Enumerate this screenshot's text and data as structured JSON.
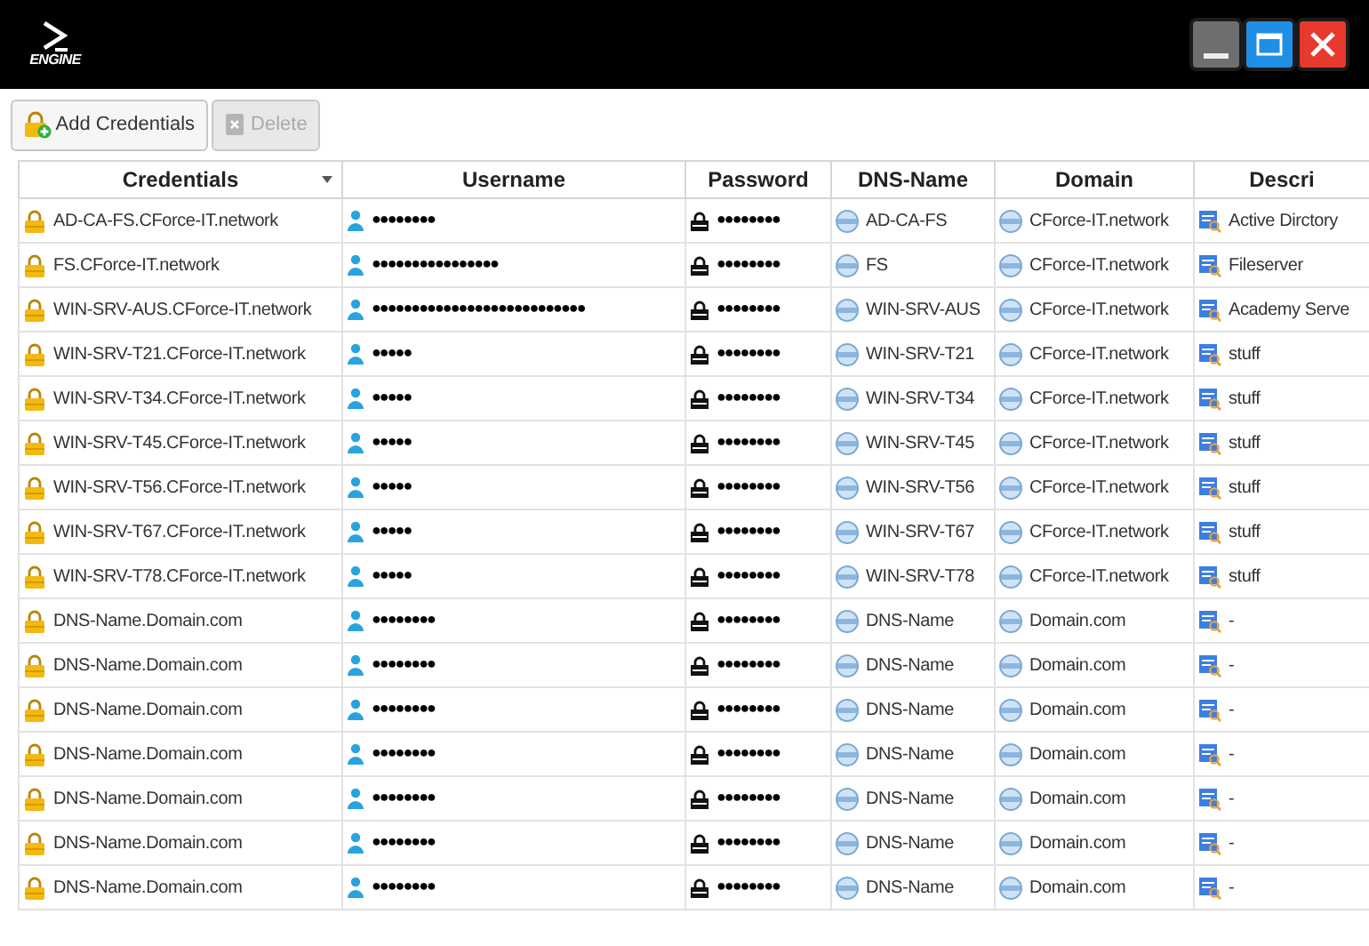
{
  "logo": {
    "text": "ENGINE"
  },
  "window_buttons": [
    {
      "kind": "minimize"
    },
    {
      "kind": "maximize"
    },
    {
      "kind": "close"
    }
  ],
  "toolbar": [
    {
      "label": "Add Credentials",
      "disabled": false,
      "kind": "add"
    },
    {
      "label": "Delete",
      "disabled": true,
      "kind": "delete"
    }
  ],
  "table": {
    "columns": [
      {
        "label": "Credentials",
        "sorted": true
      },
      {
        "label": "Username",
        "sorted": false
      },
      {
        "label": "Password",
        "sorted": false
      },
      {
        "label": "DNS-Name",
        "sorted": false
      },
      {
        "label": "Domain",
        "sorted": false
      },
      {
        "label": "Descri",
        "sorted": false
      }
    ],
    "rows": [
      {
        "credentials": "AD-CA-FS.CForce-IT.network",
        "username": "●●●●●●●●",
        "password": "●●●●●●●●",
        "dns_name": "AD-CA-FS",
        "domain": "CForce-IT.network",
        "description": "Active Dirctory"
      },
      {
        "credentials": "FS.CForce-IT.network",
        "username": "●●●●●●●●●●●●●●●●",
        "password": "●●●●●●●●",
        "dns_name": "FS",
        "domain": "CForce-IT.network",
        "description": "Fileserver"
      },
      {
        "credentials": "WIN-SRV-AUS.CForce-IT.network",
        "username": "●●●●●●●●●●●●●●●●●●●●●●●●●●●",
        "password": "●●●●●●●●",
        "dns_name": "WIN-SRV-AUS",
        "domain": "CForce-IT.network",
        "description": "Academy Serve"
      },
      {
        "credentials": "WIN-SRV-T21.CForce-IT.network",
        "username": "●●●●●",
        "password": "●●●●●●●●",
        "dns_name": "WIN-SRV-T21",
        "domain": "CForce-IT.network",
        "description": "stuff"
      },
      {
        "credentials": "WIN-SRV-T34.CForce-IT.network",
        "username": "●●●●●",
        "password": "●●●●●●●●",
        "dns_name": "WIN-SRV-T34",
        "domain": "CForce-IT.network",
        "description": "stuff"
      },
      {
        "credentials": "WIN-SRV-T45.CForce-IT.network",
        "username": "●●●●●",
        "password": "●●●●●●●●",
        "dns_name": "WIN-SRV-T45",
        "domain": "CForce-IT.network",
        "description": "stuff"
      },
      {
        "credentials": "WIN-SRV-T56.CForce-IT.network",
        "username": "●●●●●",
        "password": "●●●●●●●●",
        "dns_name": "WIN-SRV-T56",
        "domain": "CForce-IT.network",
        "description": "stuff"
      },
      {
        "credentials": "WIN-SRV-T67.CForce-IT.network",
        "username": "●●●●●",
        "password": "●●●●●●●●",
        "dns_name": "WIN-SRV-T67",
        "domain": "CForce-IT.network",
        "description": "stuff"
      },
      {
        "credentials": "WIN-SRV-T78.CForce-IT.network",
        "username": "●●●●●",
        "password": "●●●●●●●●",
        "dns_name": "WIN-SRV-T78",
        "domain": "CForce-IT.network",
        "description": "stuff"
      },
      {
        "credentials": "DNS-Name.Domain.com",
        "username": "●●●●●●●●",
        "password": "●●●●●●●●",
        "dns_name": "DNS-Name",
        "domain": "Domain.com",
        "description": "-"
      },
      {
        "credentials": "DNS-Name.Domain.com",
        "username": "●●●●●●●●",
        "password": "●●●●●●●●",
        "dns_name": "DNS-Name",
        "domain": "Domain.com",
        "description": "-"
      },
      {
        "credentials": "DNS-Name.Domain.com",
        "username": "●●●●●●●●",
        "password": "●●●●●●●●",
        "dns_name": "DNS-Name",
        "domain": "Domain.com",
        "description": "-"
      },
      {
        "credentials": "DNS-Name.Domain.com",
        "username": "●●●●●●●●",
        "password": "●●●●●●●●",
        "dns_name": "DNS-Name",
        "domain": "Domain.com",
        "description": "-"
      },
      {
        "credentials": "DNS-Name.Domain.com",
        "username": "●●●●●●●●",
        "password": "●●●●●●●●",
        "dns_name": "DNS-Name",
        "domain": "Domain.com",
        "description": "-"
      },
      {
        "credentials": "DNS-Name.Domain.com",
        "username": "●●●●●●●●",
        "password": "●●●●●●●●",
        "dns_name": "DNS-Name",
        "domain": "Domain.com",
        "description": "-"
      },
      {
        "credentials": "DNS-Name.Domain.com",
        "username": "●●●●●●●●",
        "password": "●●●●●●●●",
        "dns_name": "DNS-Name",
        "domain": "Domain.com",
        "description": "-"
      }
    ]
  }
}
